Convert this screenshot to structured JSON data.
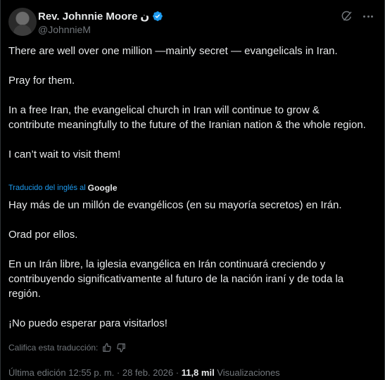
{
  "author": {
    "display_name": "Rev. Johnnie Moore",
    "name_suffix": "ن",
    "handle": "@JohnnieM"
  },
  "icons": {
    "verified": "verified-badge-icon",
    "grok": "grok-icon",
    "more": "more-options-icon",
    "thumbs_up": "thumbs-up-icon",
    "thumbs_down": "thumbs-down-icon"
  },
  "colors": {
    "accent": "#1d9bf0",
    "background": "#000000",
    "text": "#e7e9ea",
    "muted": "#71767b"
  },
  "post": {
    "paragraphs": [
      "There are well over one million —mainly secret — evangelicals in Iran.",
      "Pray for them.",
      "In a free Iran, the evangelical church in Iran will continue to grow & contribute meaningfully to the future of the Iranian nation & the whole region.",
      "I can’t wait to visit them!"
    ]
  },
  "translation": {
    "label": "Traducido del inglés al",
    "provider": "Google",
    "paragraphs": [
      "Hay más de un millón de evangélicos (en su mayoría secretos) en Irán.",
      "Orad por ellos.",
      "En un Irán libre, la iglesia evangélica en Irán continuará creciendo y contribuyendo significativamente al futuro de la nación iraní y de toda la región.",
      "¡No puedo esperar para visitarlos!"
    ],
    "rate_label": "Califica esta traducción:"
  },
  "meta": {
    "edited": "Última edición 12:55 p. m. · 28 feb. 2026 ·",
    "views_count": "11,8 mil",
    "views_label": "Visualizaciones"
  }
}
